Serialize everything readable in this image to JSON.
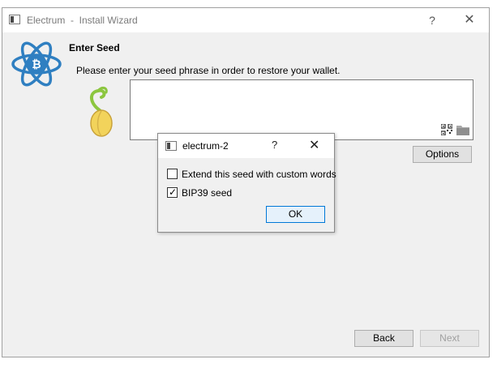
{
  "window": {
    "title": "Electrum  -  Install Wizard",
    "help_glyph": "?",
    "close_glyph": "✕"
  },
  "page": {
    "heading": "Enter Seed",
    "instruction": "Please enter your seed phrase in order to restore your wallet.",
    "seed_text": "",
    "options_label": "Options",
    "back_label": "Back",
    "next_label": "Next",
    "icons": [
      "electrum-logo-icon",
      "seed-sprout-icon",
      "qr-code-icon",
      "folder-icon"
    ]
  },
  "dialog": {
    "title": "electrum-2",
    "help_glyph": "?",
    "close_glyph": "✕",
    "options": [
      {
        "label": "Extend this seed with custom words",
        "checked": false
      },
      {
        "label": "BIP39 seed",
        "checked": true
      }
    ],
    "ok_label": "OK"
  },
  "colors": {
    "accent": "#0078d7",
    "logo_blue": "#2f7fc1",
    "window_bg": "#f0f0f0"
  }
}
